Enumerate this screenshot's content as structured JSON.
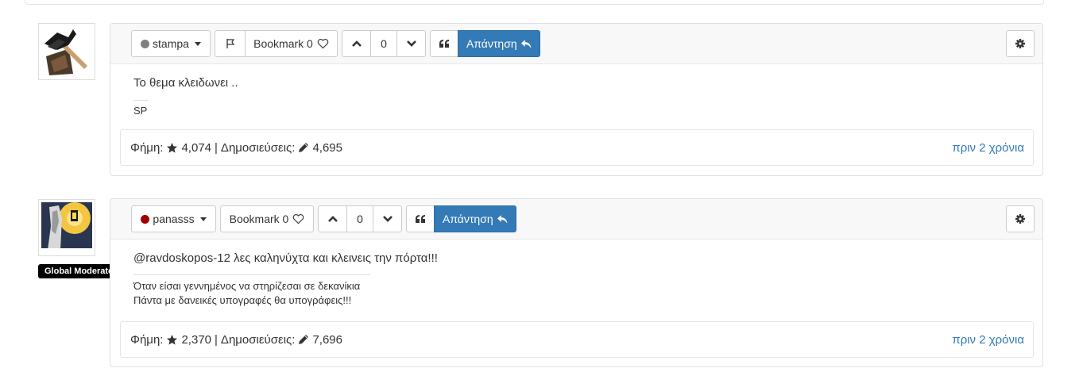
{
  "posts": [
    {
      "author": "stampa",
      "status_color": "#7f7f7f",
      "has_flag": true,
      "bookmark_label": "Bookmark 0",
      "vote_count": "0",
      "reply_label": "Απάντηση",
      "content": "Το θεμα κλειδωνει ..",
      "signature": [
        "SP"
      ],
      "stats": {
        "reputation_label": "Φήμη:",
        "reputation": "4,074",
        "separator": "|",
        "posts_label": "Δημοσιεύσεις:",
        "posts": "4,695"
      },
      "timeago": "πριν 2 χρόνια"
    },
    {
      "author": "panasss",
      "status_color": "#a00000",
      "group_badge": "Global Moderators",
      "has_flag": false,
      "bookmark_label": "Bookmark 0",
      "vote_count": "0",
      "reply_label": "Απάντηση",
      "content": "@ravdoskopos-12 λες καληνύχτα και κλεινεις την πόρτα!!!",
      "signature": [
        "Όταν είσαι γεννημένος να στηρίζεσαι σε δεκανίκια",
        "Πάντα με δανεικές υπογραφές θα υπογράφεις!!!"
      ],
      "stats": {
        "reputation_label": "Φήμη:",
        "reputation": "2,370",
        "separator": "|",
        "posts_label": "Δημοσιεύσεις:",
        "posts": "7,696"
      },
      "timeago": "πριν 2 χρόνια"
    }
  ]
}
